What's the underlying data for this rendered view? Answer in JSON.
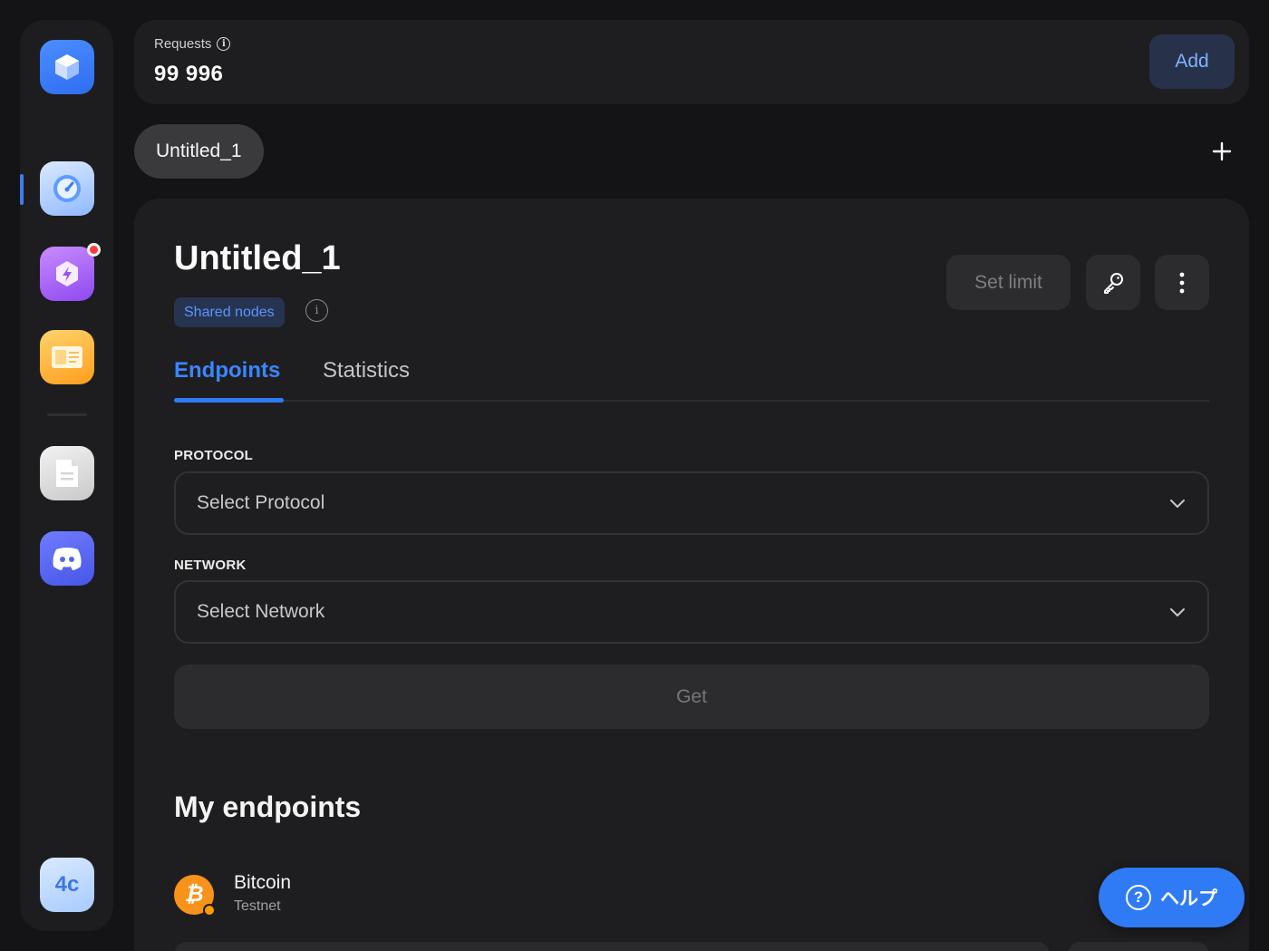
{
  "sidebar": {
    "apps": [
      {
        "name": "logo",
        "icon": "cube-logo-icon"
      },
      {
        "name": "dashboard",
        "icon": "speedometer-icon",
        "active": true
      },
      {
        "name": "boost",
        "icon": "lightning-icon",
        "notification": true
      },
      {
        "name": "docs",
        "icon": "book-icon"
      },
      {
        "name": "documents",
        "icon": "document-icon"
      },
      {
        "name": "discord",
        "icon": "discord-icon"
      }
    ],
    "user_initials": "4c"
  },
  "topbar": {
    "requests_label": "Requests",
    "requests_value": "99 996",
    "add_label": "Add"
  },
  "project_tab": {
    "label": "Untitled_1"
  },
  "card": {
    "title": "Untitled_1",
    "badge": "Shared nodes",
    "set_limit_label": "Set limit",
    "tabs": [
      {
        "label": "Endpoints",
        "active": true
      },
      {
        "label": "Statistics",
        "active": false
      }
    ],
    "protocol": {
      "label": "PROTOCOL",
      "placeholder": "Select Protocol"
    },
    "network": {
      "label": "NETWORK",
      "placeholder": "Select Network"
    },
    "get_label": "Get",
    "my_endpoints_title": "My endpoints",
    "endpoints": [
      {
        "name": "Bitcoin",
        "network": "Testnet",
        "icon": "bitcoin-icon"
      }
    ]
  },
  "help": {
    "label": "ヘルプ"
  },
  "colors": {
    "accent": "#2f7bf5",
    "background": "#141416",
    "card": "#1e1e20"
  }
}
